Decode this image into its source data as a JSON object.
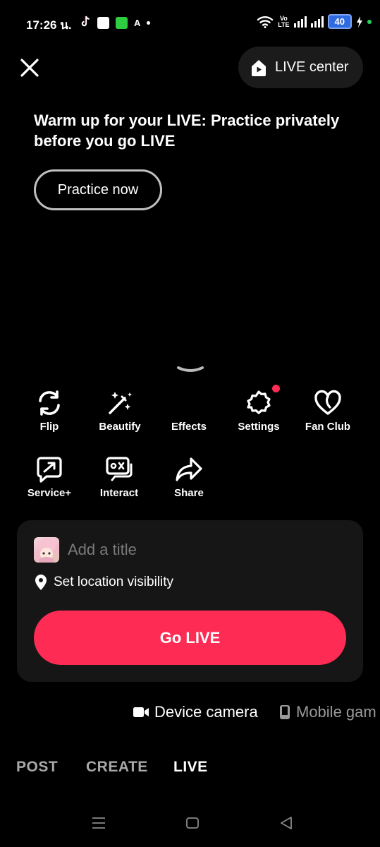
{
  "status_bar": {
    "time": "17:26 น.",
    "app_letter": "A",
    "volte_top": "Vo",
    "volte_bottom": "LTE",
    "battery": "40"
  },
  "header": {
    "live_center_label": "LIVE center"
  },
  "promo": {
    "title": "Warm up for your LIVE: Practice privately before you go LIVE",
    "practice_button": "Practice now"
  },
  "tools": [
    {
      "label": "Flip",
      "icon": "flip-camera-icon"
    },
    {
      "label": "Beautify",
      "icon": "magic-wand-icon"
    },
    {
      "label": "Effects",
      "icon": "effects-icon"
    },
    {
      "label": "Settings",
      "icon": "gear-icon"
    },
    {
      "label": "Fan Club",
      "icon": "heart-icon"
    },
    {
      "label": "Service+",
      "icon": "service-plus-icon"
    },
    {
      "label": "Interact",
      "icon": "interact-icon"
    },
    {
      "label": "Share",
      "icon": "share-arrow-icon"
    }
  ],
  "setup_card": {
    "title_placeholder": "Add a title",
    "location_label": "Set location visibility",
    "go_live_button": "Go LIVE"
  },
  "sources": [
    {
      "label": "Device camera",
      "selected": true
    },
    {
      "label": "Mobile gam",
      "selected": false
    }
  ],
  "mode_tabs": [
    {
      "label": "POST",
      "selected": false
    },
    {
      "label": "CREATE",
      "selected": false
    },
    {
      "label": "LIVE",
      "selected": true
    }
  ],
  "colors": {
    "accent": "#fe2c55",
    "background": "#000000",
    "card": "#161616"
  }
}
